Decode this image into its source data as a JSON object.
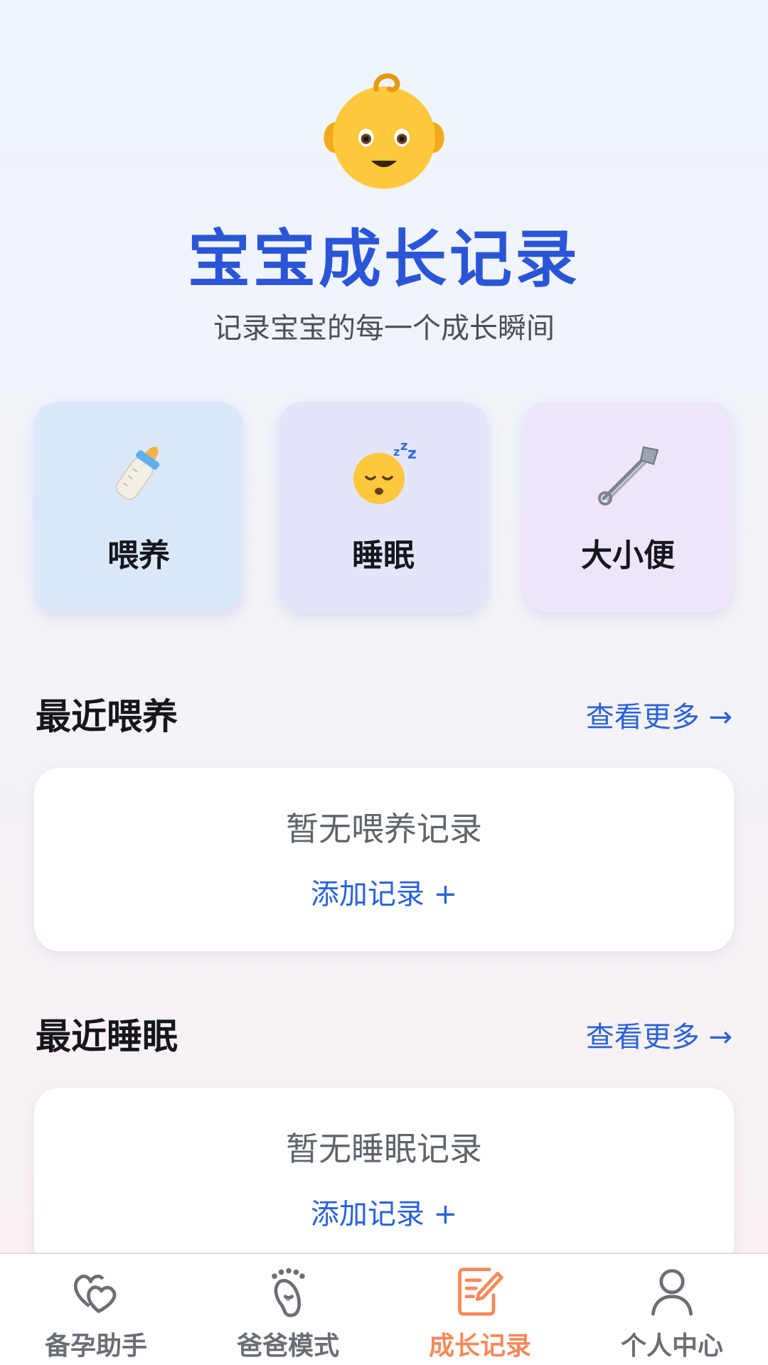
{
  "header": {
    "icon": "baby-face-icon",
    "title": "宝宝成长记录",
    "subtitle": "记录宝宝的每一个成长瞬间"
  },
  "categories": [
    {
      "label": "喂养",
      "icon": "baby-bottle-icon",
      "color": "#dbe8fc"
    },
    {
      "label": "睡眠",
      "icon": "sleeping-face-icon",
      "color": "#e3e5fb"
    },
    {
      "label": "大小便",
      "icon": "safety-pin-icon",
      "color": "#efe5fb"
    }
  ],
  "sections": {
    "feeding": {
      "title": "最近喂养",
      "more": "查看更多 →",
      "empty_text": "暂无喂养记录",
      "add_label": "添加记录 +"
    },
    "sleep": {
      "title": "最近睡眠",
      "more": "查看更多 →",
      "empty_text": "暂无睡眠记录",
      "add_label": "添加记录 +"
    }
  },
  "tabbar": {
    "active_color": "#f5895a",
    "items": [
      {
        "label": "备孕助手",
        "icon": "hearts-icon"
      },
      {
        "label": "爸爸模式",
        "icon": "footprint-icon"
      },
      {
        "label": "成长记录",
        "icon": "edit-note-icon",
        "active": true
      },
      {
        "label": "个人中心",
        "icon": "user-icon"
      }
    ]
  }
}
